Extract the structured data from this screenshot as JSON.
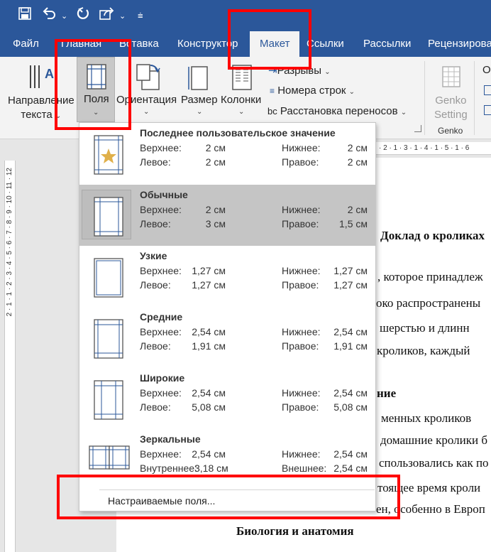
{
  "quick_access": {
    "save_icon": "save-icon",
    "undo_icon": "undo-icon",
    "redo_icon": "redo-icon",
    "share_icon": "share-icon",
    "customize_icon": "customize-icon"
  },
  "tabs": [
    "Файл",
    "Главная",
    "Вставка",
    "Конструктор",
    "Макет",
    "Ссылки",
    "Рассылки",
    "Рецензирова"
  ],
  "active_tab": "Макет",
  "ribbon": {
    "text_direction": {
      "line1": "Направление",
      "line2": "текста"
    },
    "margins": "Поля",
    "orientation": "Ориентация",
    "size": "Размер",
    "columns": "Колонки",
    "breaks": "Разрывы",
    "line_numbers": "Номера строк",
    "hyphenation": "Расстановка переносов",
    "genko": {
      "line1": "Genko",
      "line2": "Setting",
      "group": "Genko"
    },
    "extra_letter": "О"
  },
  "margins_menu": {
    "options": [
      {
        "title": "Последнее пользовательское значение",
        "top_label": "Верхнее:",
        "top": "2 см",
        "bottom_label": "Нижнее:",
        "bottom": "2 см",
        "left_label": "Левое:",
        "left": "2 см",
        "right_label": "Правое:",
        "right": "2 см",
        "icon": "custom-margin-star-icon"
      },
      {
        "title": "Обычные",
        "top_label": "Верхнее:",
        "top": "2 см",
        "bottom_label": "Нижнее:",
        "bottom": "2 см",
        "left_label": "Левое:",
        "left": "3 см",
        "right_label": "Правое:",
        "right": "1,5 см",
        "icon": "normal-margin-icon"
      },
      {
        "title": "Узкие",
        "top_label": "Верхнее:",
        "top": "1,27 см",
        "bottom_label": "Нижнее:",
        "bottom": "1,27 см",
        "left_label": "Левое:",
        "left": "1,27 см",
        "right_label": "Правое:",
        "right": "1,27 см",
        "icon": "narrow-margin-icon"
      },
      {
        "title": "Средние",
        "top_label": "Верхнее:",
        "top": "2,54 см",
        "bottom_label": "Нижнее:",
        "bottom": "2,54 см",
        "left_label": "Левое:",
        "left": "1,91 см",
        "right_label": "Правое:",
        "right": "1,91 см",
        "icon": "moderate-margin-icon"
      },
      {
        "title": "Широкие",
        "top_label": "Верхнее:",
        "top": "2,54 см",
        "bottom_label": "Нижнее:",
        "bottom": "2,54 см",
        "left_label": "Левое:",
        "left": "5,08 см",
        "right_label": "Правое:",
        "right": "5,08 см",
        "icon": "wide-margin-icon"
      },
      {
        "title": "Зеркальные",
        "top_label": "Верхнее:",
        "top": "2,54 см",
        "bottom_label": "Нижнее:",
        "bottom": "2,54 см",
        "left_label": "Внутреннее:",
        "left": "3,18 см",
        "right_label": "Внешнее:",
        "right": "2,54 см",
        "icon": "mirrored-margin-icon"
      }
    ],
    "selected": "Обычные",
    "custom": "Настраиваемые поля..."
  },
  "document": {
    "heading1": "Доклад о кроликах",
    "lines": [
      ", которое принадлеж",
      "око распространены",
      "шерстью и длинн",
      "кроликов, каждый"
    ],
    "heading2_fragment": "ние",
    "lines2": [
      "менных кроликов",
      "домашние кролики б",
      "спользовались как по",
      "тоящее время кроли",
      "ен, особенно в Европ"
    ],
    "heading3": "Биология и анатомия"
  },
  "hruler_text": "· 2 · 1 · 3 · 1 · 4 · 1 · 5 · 1 · 6",
  "vruler_text": "2 · 1 · 1 · 2 · 3 · 4 · 5 · 6 · 7 · 8 · 9 · 10 · 11 · 12",
  "colors": {
    "brand": "#2b579a",
    "annotation": "#ff0000",
    "selected": "#c5c5c5"
  }
}
